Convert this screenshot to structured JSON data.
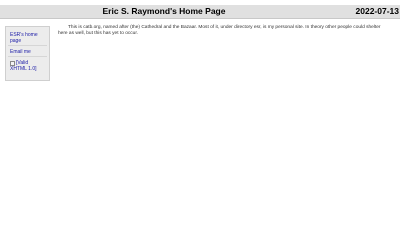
{
  "header": {
    "title": "Eric S. Raymond's Home Page",
    "date": "2022-07-13"
  },
  "sidebar": {
    "items": [
      {
        "label": "ESR's home page"
      },
      {
        "label": "Email me"
      },
      {
        "label": "[Valid XHTML 1.0]"
      }
    ]
  },
  "main": {
    "intro": "This is catb.org, named after (the) Cathedral and the Bazaar. Most of it, under directory esr, is my personal site. In theory other people could shelter here as well, but this has yet to occur."
  },
  "colors": {
    "header_bg": "#e0e0e0",
    "sidebar_bg": "#ececec",
    "link": "#1a1aa6"
  }
}
